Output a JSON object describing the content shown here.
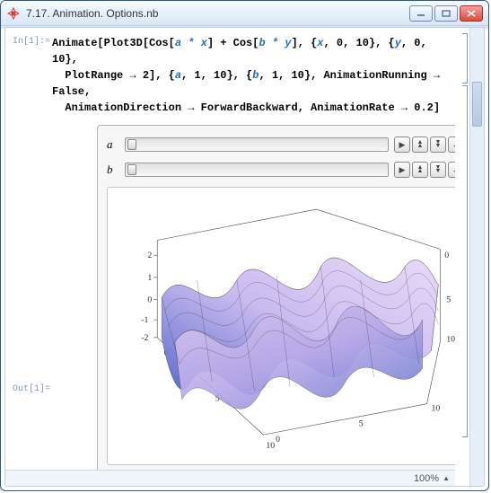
{
  "window": {
    "title": "7.17. Animation. Options.nb"
  },
  "input": {
    "label": "In[1]:=",
    "code_line1_a": "Animate[Plot3D[Cos[",
    "code_line1_b": "] + Cos[",
    "code_line1_c": "], {",
    "code_line1_d": ", 0, 10}, {",
    "code_line1_e": ", 0, 10},",
    "sym_ax": "a * x",
    "sym_by": "b * y",
    "sym_x": "x",
    "sym_y": "y",
    "code_line2_a": "  PlotRange → 2], {",
    "code_line2_b": ", 1, 10}, {",
    "code_line2_c": ", 1, 10}, AnimationRunning → False,",
    "sym_a": "a",
    "sym_b": "b",
    "code_line3": "  AnimationDirection → ForwardBackward, AnimationRate → 0.2]"
  },
  "controls": {
    "a_label": "a",
    "b_label": "b",
    "btn_play": "▶",
    "btn_up": "▲",
    "btn_down": "▼",
    "btn_loop": "↔"
  },
  "output": {
    "label": "Out[1]="
  },
  "chart_data": {
    "type": "surface3d",
    "expression": "Cos(a*x) + Cos(b*y)",
    "x_range": [
      0,
      10
    ],
    "y_range": [
      0,
      10
    ],
    "z_range": [
      -2,
      2
    ],
    "x_ticks": [
      0,
      5,
      10
    ],
    "y_ticks": [
      0,
      5,
      10
    ],
    "z_ticks": [
      -2,
      -1,
      0,
      1,
      2
    ],
    "parameters": {
      "a": 1,
      "b": 1
    }
  },
  "status": {
    "zoom": "100%"
  }
}
